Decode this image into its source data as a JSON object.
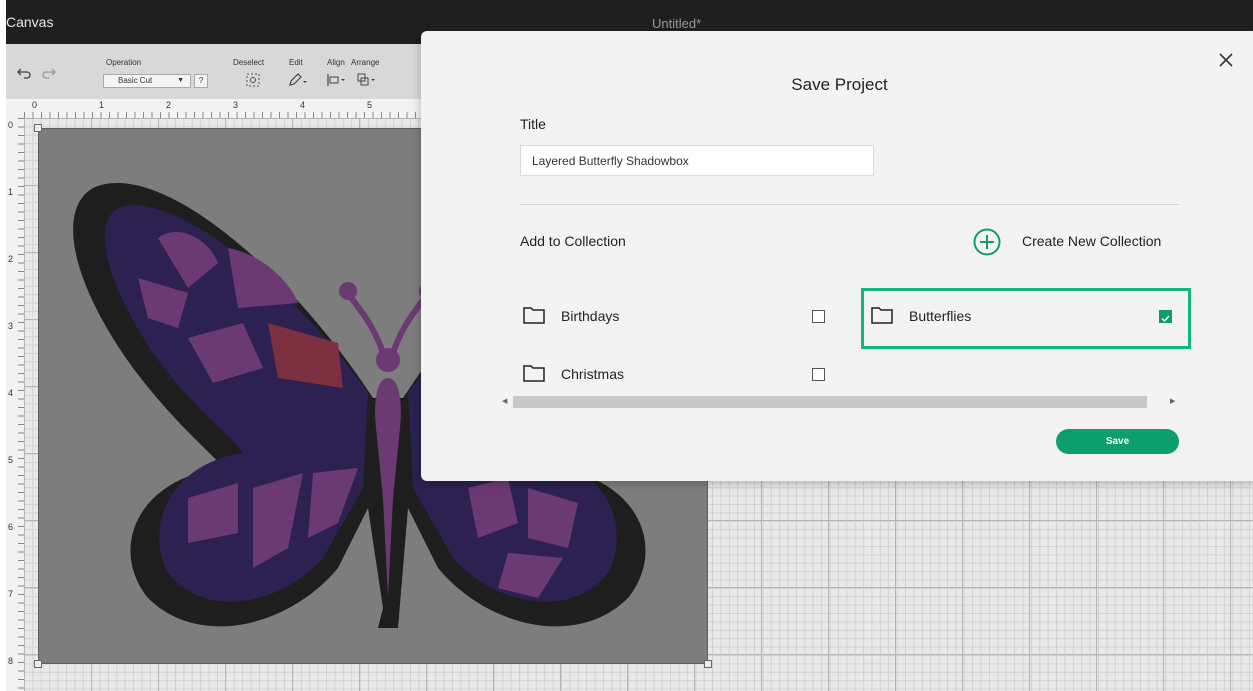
{
  "app": {
    "name": "Canvas",
    "document_title": "Untitled*"
  },
  "toolbar": {
    "operation_label": "Operation",
    "operation_value": "Basic Cut",
    "operation_help": "?",
    "deselect_label": "Deselect",
    "edit_label": "Edit",
    "align_label": "Align",
    "arrange_label": "Arrange"
  },
  "rulers": {
    "horizontal": [
      "0",
      "1",
      "2",
      "3",
      "4",
      "5"
    ],
    "vertical": [
      "0",
      "1",
      "2",
      "3",
      "4",
      "5",
      "6",
      "7",
      "8"
    ]
  },
  "dialog": {
    "heading": "Save Project",
    "title_label": "Title",
    "title_value": "Layered Butterfly Shadowbox",
    "add_to_collection_label": "Add to Collection",
    "create_new_collection_label": "Create New Collection",
    "collections": [
      {
        "name": "Birthdays",
        "checked": false
      },
      {
        "name": "Butterflies",
        "checked": true
      },
      {
        "name": "Christmas",
        "checked": false
      }
    ],
    "save_label": "Save"
  },
  "colors": {
    "accent": "#0d9e6e",
    "highlight": "#14b484",
    "wing_outer": "#1e1e1e",
    "wing_mid": "#2c2150",
    "wing_inner": "#6b3a73",
    "wing_red": "#7c2f3e"
  },
  "icons": {
    "undo": "undo-icon",
    "redo": "redo-icon",
    "deselect": "deselect-icon",
    "edit": "pencil-icon",
    "align": "align-icon",
    "arrange": "arrange-icon",
    "close": "close-icon",
    "create_collection": "plus-circle-icon",
    "folder": "folder-icon",
    "check": "check-icon"
  }
}
